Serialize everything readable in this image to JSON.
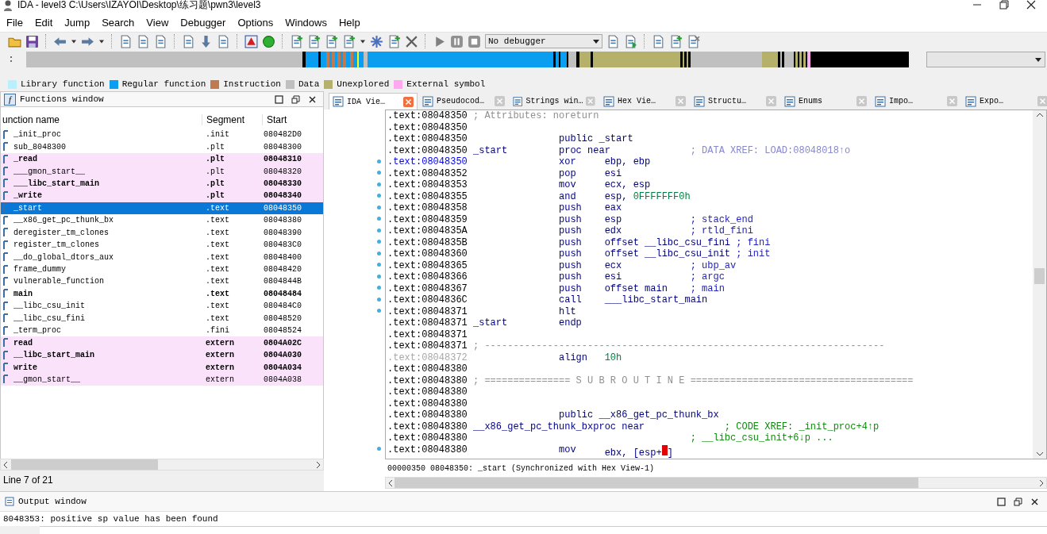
{
  "window": {
    "title": "IDA - level3 C:\\Users\\IZAYOI\\Desktop\\练习题\\pwn3\\level3"
  },
  "menu": [
    "File",
    "Edit",
    "Jump",
    "Search",
    "View",
    "Debugger",
    "Options",
    "Windows",
    "Help"
  ],
  "debugger_select": {
    "value": "No debugger"
  },
  "legend": [
    {
      "label": "Library function",
      "color": "#b8f0ff"
    },
    {
      "label": "Regular function",
      "color": "#0a9ef0"
    },
    {
      "label": "Instruction",
      "color": "#c07a50"
    },
    {
      "label": "Data",
      "color": "#c0c0c0"
    },
    {
      "label": "Unexplored",
      "color": "#b5b06a"
    },
    {
      "label": "External symbol",
      "color": "#ffa8f0"
    }
  ],
  "functions": {
    "title": "Functions window",
    "icon_glyph": "f",
    "columns": [
      "unction name",
      "Segment",
      "Start"
    ],
    "rows": [
      {
        "name": "_init_proc",
        "segment": ".init",
        "start": "080482D0",
        "external": false,
        "bold": false,
        "selected": false
      },
      {
        "name": "sub_8048300",
        "segment": ".plt",
        "start": "08048300",
        "external": false,
        "bold": false,
        "selected": false
      },
      {
        "name": "_read",
        "segment": ".plt",
        "start": "08048310",
        "external": true,
        "bold": true,
        "selected": false
      },
      {
        "name": "___gmon_start__",
        "segment": ".plt",
        "start": "08048320",
        "external": true,
        "bold": false,
        "selected": false
      },
      {
        "name": "___libc_start_main",
        "segment": ".plt",
        "start": "08048330",
        "external": true,
        "bold": true,
        "selected": false
      },
      {
        "name": "_write",
        "segment": ".plt",
        "start": "08048340",
        "external": true,
        "bold": true,
        "selected": false
      },
      {
        "name": "_start",
        "segment": ".text",
        "start": "08048350",
        "external": false,
        "bold": false,
        "selected": true
      },
      {
        "name": "__x86_get_pc_thunk_bx",
        "segment": ".text",
        "start": "08048380",
        "external": false,
        "bold": false,
        "selected": false
      },
      {
        "name": "deregister_tm_clones",
        "segment": ".text",
        "start": "08048390",
        "external": false,
        "bold": false,
        "selected": false
      },
      {
        "name": "register_tm_clones",
        "segment": ".text",
        "start": "080483C0",
        "external": false,
        "bold": false,
        "selected": false
      },
      {
        "name": "__do_global_dtors_aux",
        "segment": ".text",
        "start": "08048400",
        "external": false,
        "bold": false,
        "selected": false
      },
      {
        "name": "frame_dummy",
        "segment": ".text",
        "start": "08048420",
        "external": false,
        "bold": false,
        "selected": false
      },
      {
        "name": "vulnerable_function",
        "segment": ".text",
        "start": "0804844B",
        "external": false,
        "bold": false,
        "selected": false
      },
      {
        "name": "main",
        "segment": ".text",
        "start": "08048484",
        "external": false,
        "bold": true,
        "selected": false
      },
      {
        "name": "__libc_csu_init",
        "segment": ".text",
        "start": "080484C0",
        "external": false,
        "bold": false,
        "selected": false
      },
      {
        "name": "__libc_csu_fini",
        "segment": ".text",
        "start": "08048520",
        "external": false,
        "bold": false,
        "selected": false
      },
      {
        "name": "_term_proc",
        "segment": ".fini",
        "start": "08048524",
        "external": false,
        "bold": false,
        "selected": false
      },
      {
        "name": "read",
        "segment": "extern",
        "start": "0804A02C",
        "external": true,
        "bold": true,
        "selected": false
      },
      {
        "name": "__libc_start_main",
        "segment": "extern",
        "start": "0804A030",
        "external": true,
        "bold": true,
        "selected": false
      },
      {
        "name": "write",
        "segment": "extern",
        "start": "0804A034",
        "external": true,
        "bold": true,
        "selected": false
      },
      {
        "name": "__gmon_start__",
        "segment": "extern",
        "start": "0804A038",
        "external": true,
        "bold": false,
        "selected": false
      }
    ],
    "status": "Line 7 of 21"
  },
  "tabs": [
    {
      "label": "IDA Vie…",
      "selected": true
    },
    {
      "label": "Pseudocod…",
      "selected": false
    },
    {
      "label": "Strings win…",
      "selected": false
    },
    {
      "label": "Hex Vie…",
      "selected": false
    },
    {
      "label": "Structu…",
      "selected": false
    },
    {
      "label": "Enums",
      "selected": false
    },
    {
      "label": "Impo…",
      "selected": false
    },
    {
      "label": "Expo…",
      "selected": false
    }
  ],
  "disassembly": {
    "lines": [
      {
        "kind": "comment_line",
        "address": {
          "text": ".text:08048350",
          "kind": "normal"
        },
        "comment": {
          "text": "; Attributes: noreturn",
          "kind": "attribute"
        },
        "marker": false
      },
      {
        "kind": "instruction",
        "address": {
          "text": ".text:08048350",
          "kind": "normal"
        },
        "marker": false
      },
      {
        "kind": "instruction",
        "address": {
          "text": ".text:08048350",
          "kind": "normal"
        },
        "mnemonic": "public _start",
        "marker": false
      },
      {
        "kind": "instruction",
        "address": {
          "text": ".text:08048350",
          "kind": "normal"
        },
        "label": "_start",
        "mnemonic": "proc near",
        "comment": {
          "text": "; DATA XREF: LOAD:08048018↑o",
          "kind": "xref"
        },
        "marker": false
      },
      {
        "kind": "instruction",
        "address": {
          "text": ".text:08048350",
          "kind": "current"
        },
        "mnemonic": "xor",
        "operands": "ebp, ebp",
        "marker": true
      },
      {
        "kind": "instruction",
        "address": {
          "text": ".text:08048352",
          "kind": "normal"
        },
        "mnemonic": "pop",
        "operands": "esi",
        "marker": true
      },
      {
        "kind": "instruction",
        "address": {
          "text": ".text:08048353",
          "kind": "normal"
        },
        "mnemonic": "mov",
        "operands": "ecx, esp",
        "marker": true
      },
      {
        "kind": "instruction",
        "address": {
          "text": ".text:08048355",
          "kind": "normal"
        },
        "mnemonic": "and",
        "operands": "esp, ",
        "number": "0FFFFFFF0h",
        "marker": true
      },
      {
        "kind": "instruction",
        "address": {
          "text": ".text:08048358",
          "kind": "normal"
        },
        "mnemonic": "push",
        "operands": "eax",
        "marker": true
      },
      {
        "kind": "instruction",
        "address": {
          "text": ".text:08048359",
          "kind": "normal"
        },
        "mnemonic": "push",
        "operands": "esp",
        "comment": {
          "text": "; stack_end",
          "kind": "argument"
        },
        "marker": true
      },
      {
        "kind": "instruction",
        "address": {
          "text": ".text:0804835A",
          "kind": "normal"
        },
        "mnemonic": "push",
        "operands": "edx",
        "comment": {
          "text": "; rtld_fini",
          "kind": "argument"
        },
        "marker": true
      },
      {
        "kind": "instruction",
        "address": {
          "text": ".text:0804835B",
          "kind": "normal"
        },
        "mnemonic": "push",
        "operands": "offset __libc_csu_fini",
        "comment": {
          "text": "; fini",
          "kind": "argument"
        },
        "marker": true
      },
      {
        "kind": "instruction",
        "address": {
          "text": ".text:08048360",
          "kind": "normal"
        },
        "mnemonic": "push",
        "operands": "offset __libc_csu_init",
        "comment": {
          "text": "; init",
          "kind": "argument"
        },
        "marker": true
      },
      {
        "kind": "instruction",
        "address": {
          "text": ".text:08048365",
          "kind": "normal"
        },
        "mnemonic": "push",
        "operands": "ecx",
        "comment": {
          "text": "; ubp_av",
          "kind": "argument"
        },
        "marker": true
      },
      {
        "kind": "instruction",
        "address": {
          "text": ".text:08048366",
          "kind": "normal"
        },
        "mnemonic": "push",
        "operands": "esi",
        "comment": {
          "text": "; argc",
          "kind": "argument"
        },
        "marker": true
      },
      {
        "kind": "instruction",
        "address": {
          "text": ".text:08048367",
          "kind": "normal"
        },
        "mnemonic": "push",
        "operands": "offset main",
        "comment": {
          "text": "; main",
          "kind": "argument"
        },
        "marker": true
      },
      {
        "kind": "instruction",
        "address": {
          "text": ".text:0804836C",
          "kind": "normal"
        },
        "mnemonic": "call",
        "operands": "___libc_start_main",
        "marker": true
      },
      {
        "kind": "instruction",
        "address": {
          "text": ".text:08048371",
          "kind": "normal"
        },
        "mnemonic": "hlt",
        "marker": true
      },
      {
        "kind": "instruction",
        "address": {
          "text": ".text:08048371",
          "kind": "normal"
        },
        "label": "_start",
        "mnemonic": "endp",
        "marker": false
      },
      {
        "kind": "instruction",
        "address": {
          "text": ".text:08048371",
          "kind": "normal"
        },
        "marker": false
      },
      {
        "kind": "comment_line",
        "address": {
          "text": ".text:08048371",
          "kind": "normal"
        },
        "comment": {
          "text": "; ----------------------------------------------------------------------",
          "kind": "separator"
        },
        "marker": false
      },
      {
        "kind": "instruction",
        "address": {
          "text": ".text:08048372",
          "kind": "dim"
        },
        "mnemonic": "align",
        "number": "10h",
        "marker": false
      },
      {
        "kind": "instruction",
        "address": {
          "text": ".text:08048380",
          "kind": "normal"
        },
        "marker": false
      },
      {
        "kind": "comment_line",
        "address": {
          "text": ".text:08048380",
          "kind": "normal"
        },
        "comment": {
          "text": "; =============== S U B R O U T I N E =======================================",
          "kind": "separator"
        },
        "marker": false
      },
      {
        "kind": "instruction",
        "address": {
          "text": ".text:08048380",
          "kind": "normal"
        },
        "marker": false
      },
      {
        "kind": "instruction",
        "address": {
          "text": ".text:08048380",
          "kind": "normal"
        },
        "marker": false
      },
      {
        "kind": "instruction",
        "address": {
          "text": ".text:08048380",
          "kind": "normal"
        },
        "mnemonic": "public __x86_get_pc_thunk_bx",
        "marker": false
      },
      {
        "kind": "instruction",
        "address": {
          "text": ".text:08048380",
          "kind": "normal"
        },
        "label": "__x86_get_pc_thunk_bx",
        "mnemonic": "proc near",
        "comment": {
          "text": "; CODE XREF: _init_proc+4↑p",
          "kind": "code_xref"
        },
        "marker": false
      },
      {
        "kind": "instruction",
        "address": {
          "text": ".text:08048380",
          "kind": "normal"
        },
        "comment": {
          "text": "; __libc_csu_init+6↓p ...",
          "kind": "code_xref"
        },
        "marker": false
      },
      {
        "kind": "instruction",
        "address": {
          "text": ".text:08048380",
          "kind": "normal"
        },
        "mnemonic": "mov",
        "operands": "ebx, [esp+",
        "caret": true,
        "operands_end": "]",
        "marker": true
      }
    ],
    "status": "00000350 08048350: _start (Synchronized with Hex View-1)"
  },
  "output": {
    "title": "Output window",
    "message": "8048353: positive sp value has been found"
  }
}
